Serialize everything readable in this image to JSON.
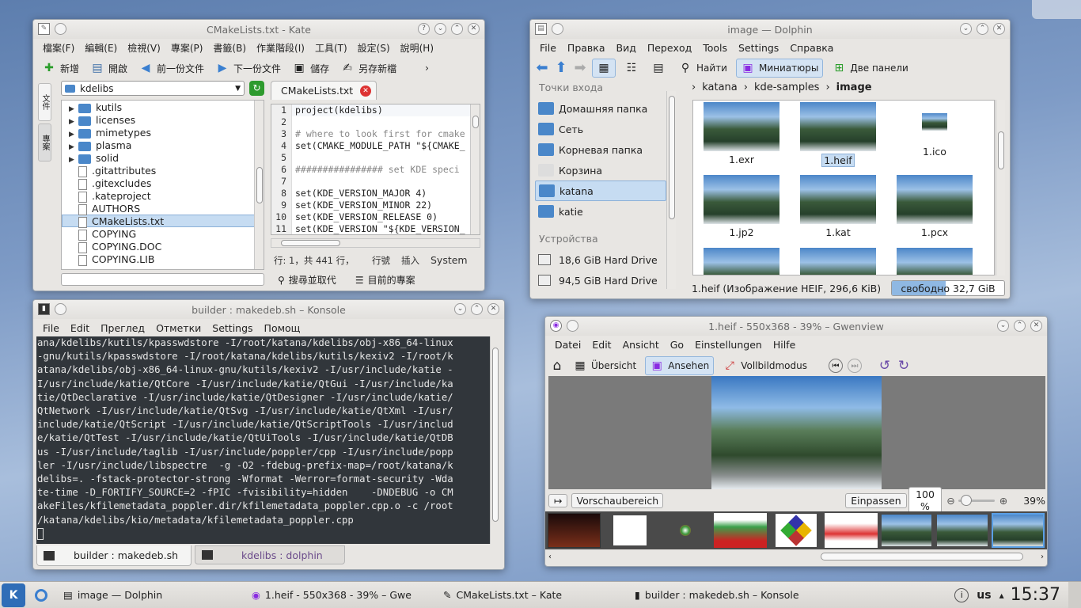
{
  "kate": {
    "title": "CMakeLists.txt - Kate",
    "menu": [
      "檔案(F)",
      "編輯(E)",
      "檢視(V)",
      "專案(P)",
      "書籤(B)",
      "作業階段(I)",
      "工具(T)",
      "設定(S)",
      "說明(H)"
    ],
    "toolbar": [
      "新增",
      "開啟",
      "前一份文件",
      "下一份文件",
      "儲存",
      "另存新檔"
    ],
    "side_tabs": [
      "文件",
      "專案"
    ],
    "folder_select": "kdelibs",
    "tree": [
      {
        "name": "kutils",
        "type": "folder"
      },
      {
        "name": "licenses",
        "type": "folder"
      },
      {
        "name": "mimetypes",
        "type": "folder"
      },
      {
        "name": "plasma",
        "type": "folder"
      },
      {
        "name": "solid",
        "type": "folder"
      },
      {
        "name": ".gitattributes",
        "type": "file"
      },
      {
        "name": ".gitexcludes",
        "type": "file"
      },
      {
        "name": ".kateproject",
        "type": "file"
      },
      {
        "name": "AUTHORS",
        "type": "file"
      },
      {
        "name": "CMakeLists.txt",
        "type": "file",
        "selected": true
      },
      {
        "name": "COPYING",
        "type": "file"
      },
      {
        "name": "COPYING.DOC",
        "type": "file"
      },
      {
        "name": "COPYING.LIB",
        "type": "file"
      }
    ],
    "doc_tab": "CMakeLists.txt",
    "code": [
      {
        "n": "1",
        "t": "project(kdelibs)"
      },
      {
        "n": "2",
        "t": ""
      },
      {
        "n": "3",
        "t": "# where to look first for cmake"
      },
      {
        "n": "4",
        "t": "set(CMAKE_MODULE_PATH \"${CMAKE_"
      },
      {
        "n": "5",
        "t": ""
      },
      {
        "n": "6",
        "t": "################ set KDE speci"
      },
      {
        "n": "7",
        "t": ""
      },
      {
        "n": "8",
        "t": "set(KDE_VERSION_MAJOR 4)"
      },
      {
        "n": "9",
        "t": "set(KDE_VERSION_MINOR 22)"
      },
      {
        "n": "10",
        "t": "set(KDE_VERSION_RELEASE 0)"
      },
      {
        "n": "11",
        "t": "set(KDE_VERSION \"${KDE_VERSION_"
      }
    ],
    "status": {
      "pos": "行: 1，共 441 行，",
      "mode": "行號",
      "insert": "插入",
      "enc": "System"
    },
    "bottom": [
      "搜尋並取代",
      "目前的專案"
    ]
  },
  "dolphin": {
    "title": "image — Dolphin",
    "menu": [
      "File",
      "Правка",
      "Вид",
      "Переход",
      "Tools",
      "Settings",
      "Справка"
    ],
    "toolbar": {
      "find": "Найти",
      "thumbs": "Миниатюры",
      "split": "Две панели"
    },
    "places_header": "Точки входа",
    "places": [
      "Домашняя папка",
      "Сеть",
      "Корневая папка",
      "Корзина",
      "katana",
      "katie"
    ],
    "devices_header": "Устройства",
    "devices": [
      "18,6 GiB Hard Drive",
      "94,5 GiB Hard Drive"
    ],
    "breadcrumb": [
      "katana",
      "kde-samples",
      "image"
    ],
    "files": [
      "1.exr",
      "1.heif",
      "1.ico",
      "1.jp2",
      "1.kat",
      "1.pcx"
    ],
    "status": "1.heif (Изображение HEIF, 296,6 KiB)",
    "free": "свободно 32,7 GiB",
    "free_fraction": 0.48
  },
  "konsole": {
    "title": "builder : makedeb.sh – Konsole",
    "menu": [
      "File",
      "Edit",
      "Преглед",
      "Отметки",
      "Settings",
      "Помощ"
    ],
    "lines": [
      "ana/kdelibs/kutils/kpasswdstore -I/root/katana/kdelibs/obj-x86_64-linux",
      "-gnu/kutils/kpasswdstore -I/root/katana/kdelibs/kutils/kexiv2 -I/root/k",
      "atana/kdelibs/obj-x86_64-linux-gnu/kutils/kexiv2 -I/usr/include/katie -",
      "I/usr/include/katie/QtCore -I/usr/include/katie/QtGui -I/usr/include/ka",
      "tie/QtDeclarative -I/usr/include/katie/QtDesigner -I/usr/include/katie/",
      "QtNetwork -I/usr/include/katie/QtSvg -I/usr/include/katie/QtXml -I/usr/",
      "include/katie/QtScript -I/usr/include/katie/QtScriptTools -I/usr/includ",
      "e/katie/QtTest -I/usr/include/katie/QtUiTools -I/usr/include/katie/QtDB",
      "us -I/usr/include/taglib -I/usr/include/poppler/cpp -I/usr/include/popp",
      "ler -I/usr/include/libspectre  -g -O2 -fdebug-prefix-map=/root/katana/k",
      "delibs=. -fstack-protector-strong -Wformat -Werror=format-security -Wda",
      "te-time -D_FORTIFY_SOURCE=2 -fPIC -fvisibility=hidden    -DNDEBUG -o CM",
      "akeFiles/kfilemetadata_poppler.dir/kfilemetadata_poppler.cpp.o -c /root",
      "/katana/kdelibs/kio/metadata/kfilemetadata_poppler.cpp"
    ],
    "tabs": [
      "builder : makedeb.sh",
      "kdelibs : dolphin"
    ]
  },
  "gwenview": {
    "title": "1.heif - 550x368 - 39% – Gwenview",
    "menu": [
      "Datei",
      "Edit",
      "Ansicht",
      "Go",
      "Einstellungen",
      "Hilfe"
    ],
    "toolbar": {
      "overview": "Übersicht",
      "view": "Ansehen",
      "fullscreen": "Vollbildmodus"
    },
    "preview_label": "Vorschaubereich",
    "fit": "Einpassen",
    "zoom_input": "100 %",
    "zoom_value": "39%",
    "zoom_fraction": 0.03
  },
  "taskbar": {
    "tasks": [
      "image — Dolphin",
      "1.heif - 550x368 - 39% – Gwe",
      "CMakeLists.txt – Kate",
      "builder : makedeb.sh – Konsole"
    ],
    "lang": "us",
    "clock": "15:37"
  },
  "colors": {
    "selection": "#c6dcf2",
    "accent": "#4a87c9",
    "terminal_bg": "#31363b",
    "terminal_fg": "#e6e6e6"
  }
}
